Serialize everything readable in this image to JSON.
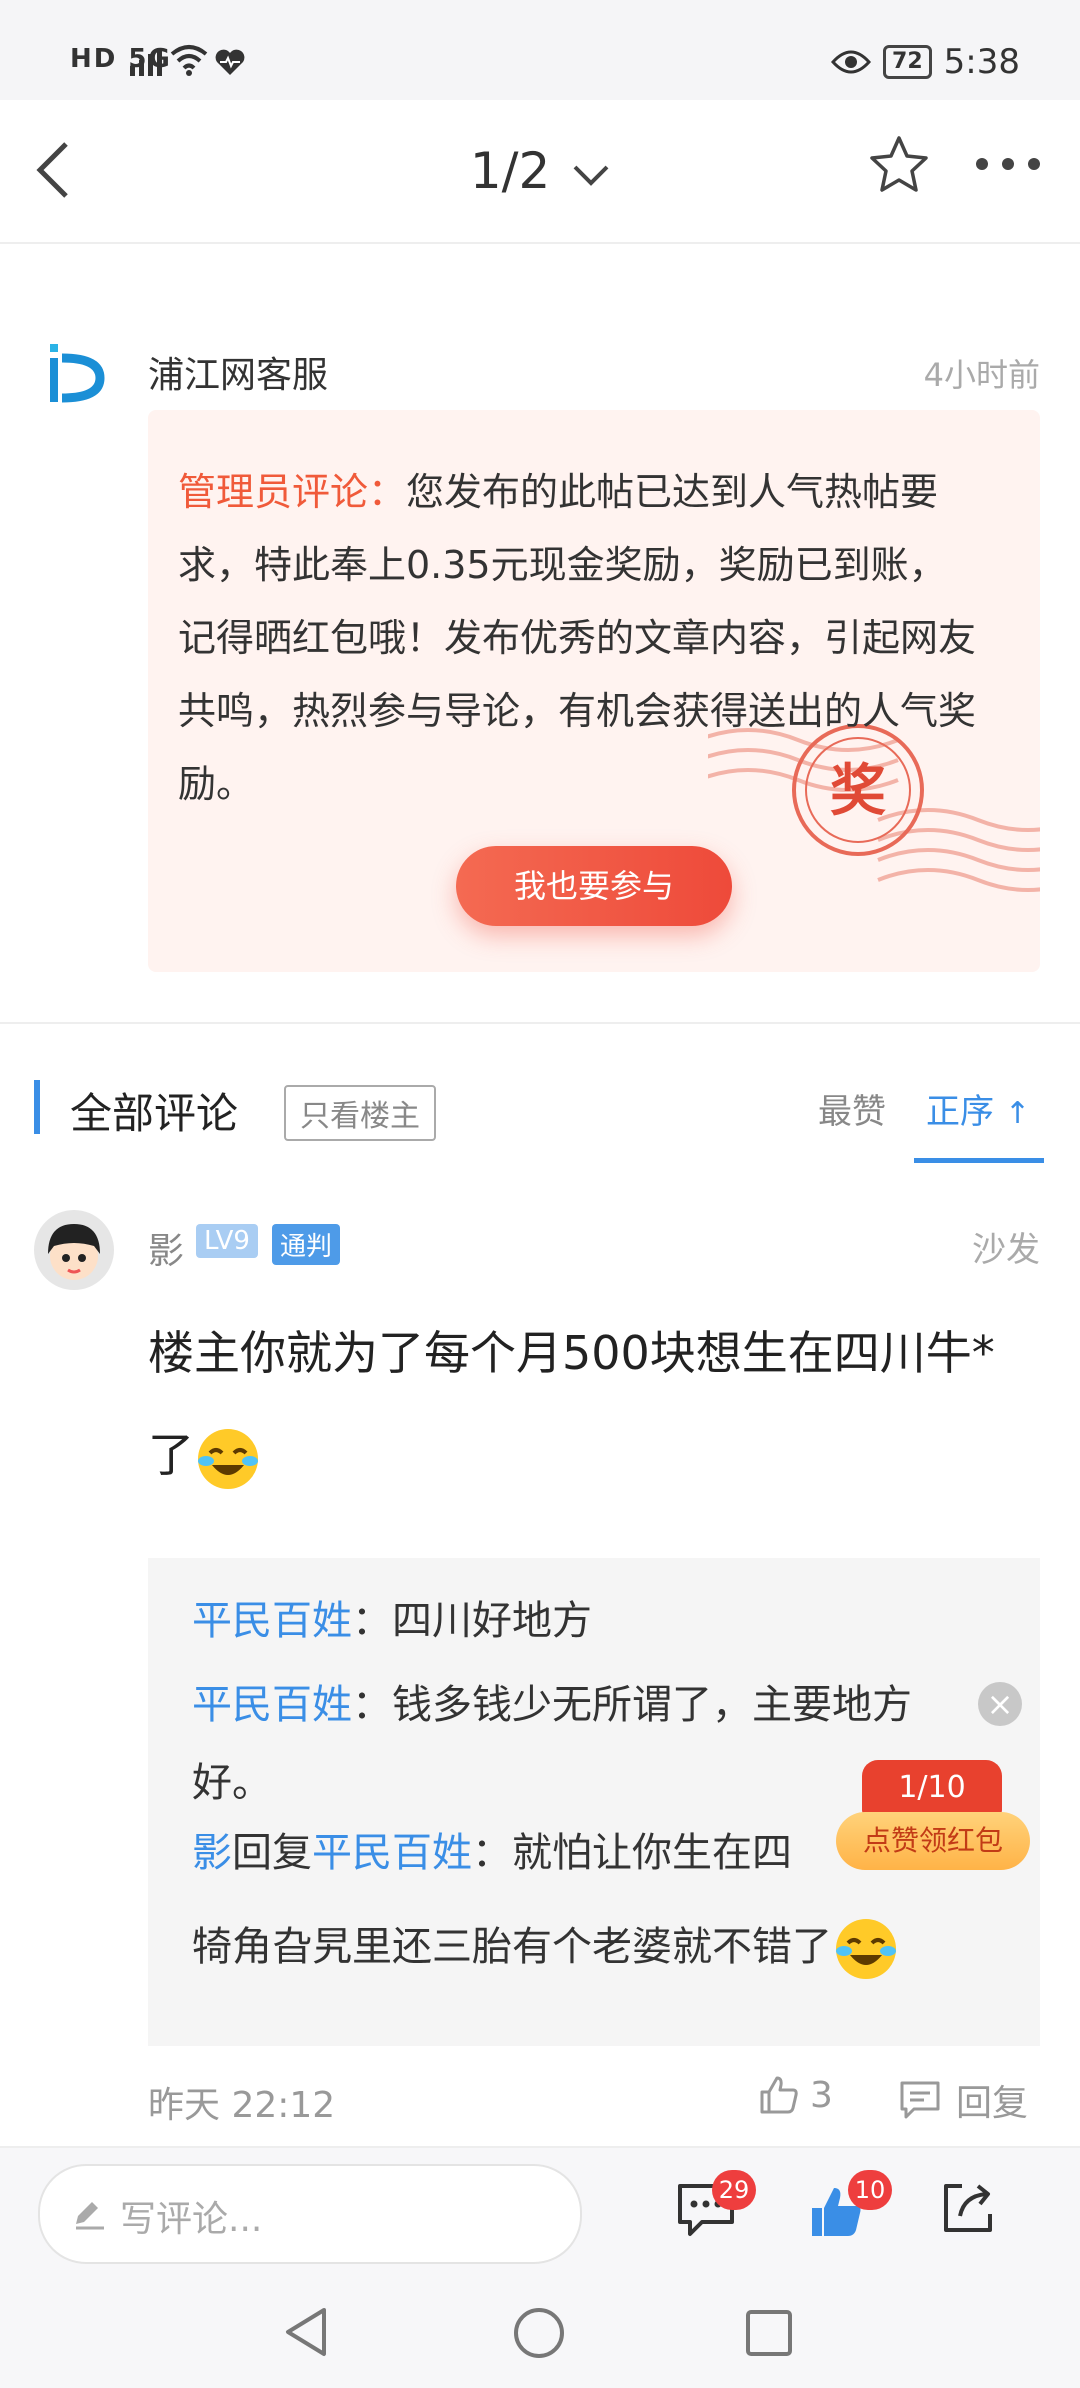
{
  "status_bar": {
    "network": "HD 5G",
    "battery": "72",
    "time": "5:38",
    "icons": [
      "signal-icon",
      "wifi-icon",
      "heart-icon",
      "eye-icon",
      "battery-icon"
    ]
  },
  "top_nav": {
    "pager": "1/2",
    "icons": [
      "back-icon",
      "chevron-down-icon",
      "star-icon",
      "more-icon"
    ]
  },
  "admin": {
    "name": "浦江网客服",
    "time": "4小时前",
    "tag": "管理员评论：",
    "text": "您发布的此帖已达到人气热帖要求，特此奉上0.35元现金奖励，奖励已到账，记得晒红包哦！发布优秀的文章内容，引起网友共鸣，热烈参与导论，有机会获得送出的人气奖励。",
    "stamp_char": "奖",
    "join_button": "我也要参与"
  },
  "comments_header": {
    "title": "全部评论",
    "only_host": "只看楼主",
    "sort_hot": "最赞",
    "sort_asc": "正序",
    "sort_arrow": "↑"
  },
  "comment": {
    "user": "影",
    "level": "LV9",
    "rank": "通判",
    "floor": "沙发",
    "text": "楼主你就为了每个月500块想生在四川牛*了",
    "time": "昨天 22:12",
    "likes": "3",
    "reply_label": "回复",
    "replies": [
      {
        "user": "平民百姓",
        "sep": "：",
        "text": "四川好地方"
      },
      {
        "user": "平民百姓",
        "sep": "：",
        "text": "钱多钱少无所谓了，主要地方好。"
      },
      {
        "user": "影",
        "verb": "回复",
        "target": "平民百姓",
        "sep": "：",
        "text": "就怕让你生在四"
      }
    ],
    "reply_tail": "犄角旮旯里还三胎有个老婆就不错了"
  },
  "float_promo": {
    "count": "1/10",
    "label": "点赞领红包",
    "close": "×"
  },
  "bottom_bar": {
    "write_placeholder": "写评论...",
    "comment_badge": "29",
    "like_badge": "10"
  }
}
